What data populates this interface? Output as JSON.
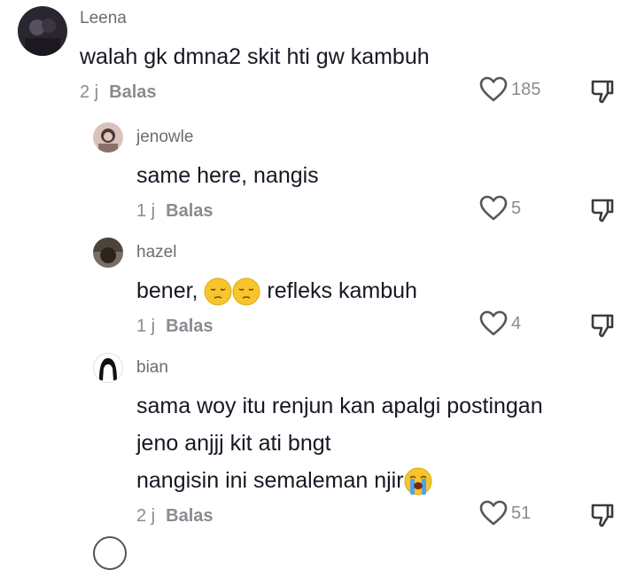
{
  "comments": [
    {
      "username": "Leena",
      "text_lines": [
        "walah gk dmna2 skit hti gw kambuh"
      ],
      "time": "2 j",
      "reply_label": "Balas",
      "likes": "185",
      "avatar_colors": [
        "#2a2630",
        "#574e5e"
      ]
    },
    {
      "username": "jenowle",
      "text_lines": [
        "same here, nangis"
      ],
      "time": "1 j",
      "reply_label": "Balas",
      "likes": "5",
      "avatar_colors": [
        "#c9a9a0",
        "#4a3a3a"
      ]
    },
    {
      "username": "hazel",
      "text_pre": "bener, ",
      "text_post": " refleks kambuh",
      "emojis": [
        "pensive-face",
        "pensive-face"
      ],
      "time": "1 j",
      "reply_label": "Balas",
      "likes": "4",
      "avatar_colors": [
        "#2b2520",
        "#7a6e63"
      ]
    },
    {
      "username": "bian",
      "text_lines": [
        "sama woy itu renjun kan apalgi postingan",
        "jeno anjjj kit ati bngt"
      ],
      "text_last": "nangisin ini semaleman njir",
      "emojis": [
        "loudly-crying-face"
      ],
      "time": "2 j",
      "reply_label": "Balas",
      "likes": "51",
      "avatar_colors": [
        "#ffffff",
        "#111111"
      ]
    }
  ],
  "colors": {
    "text": "#161823",
    "muted": "#8a8b91",
    "username": "#6c6c74",
    "emoji_yellow": "#f7c52b"
  }
}
